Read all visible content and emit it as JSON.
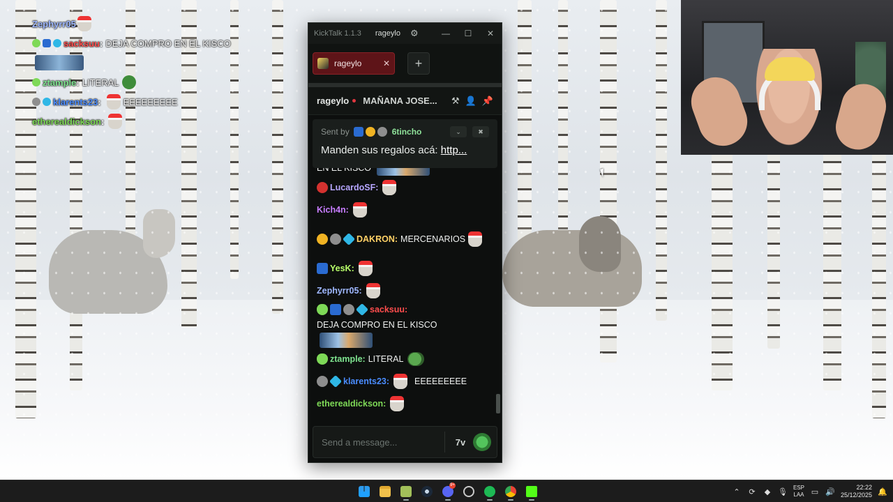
{
  "overlay": {
    "lines": [
      {
        "user": "Zephyrr05",
        "user_color": "#9fb8ff",
        "message": ""
      },
      {
        "user": "sacksuu",
        "user_color": "#ff4d4d",
        "message": "DEJA COMPRO EN EL KISCO"
      },
      {
        "user": "ztample",
        "user_color": "#7ee38f",
        "message": "LITERAL"
      },
      {
        "user": "klarents23",
        "user_color": "#4a8cff",
        "message": "EEEEEEEEE"
      },
      {
        "user": "etherealdickson",
        "user_color": "#7ed957",
        "message": ""
      }
    ]
  },
  "kicktalk": {
    "app_title": "KickTalk 1.1.3",
    "titlebar_channel": "rageylo",
    "tabs": [
      {
        "label": "rageylo"
      }
    ],
    "stream": {
      "streamer": "rageylo",
      "title": "MAÑANA JOSE..."
    },
    "pinned": {
      "sent_by_label": "Sent by",
      "user": "6tincho",
      "message_prefix": "Manden sus regalos acá: ",
      "link": "http..."
    },
    "messages": [
      {
        "user": "",
        "user_color": "#ffffff",
        "text": "EN EL KISCO",
        "badges": [],
        "emote": "wide"
      },
      {
        "user": "LucardoSF:",
        "user_color": "#b6a6ff",
        "text": "",
        "badges": [
          "red"
        ],
        "emote": "skull"
      },
      {
        "user": "Kich4n:",
        "user_color": "#c77dff",
        "text": "",
        "badges": [],
        "emote": "skull"
      },
      {
        "user": "DAKRON:",
        "user_color": "#ffd166",
        "text": "MERCENARIOS",
        "badges": [
          "one",
          "grey",
          "cube"
        ],
        "emote": "skull"
      },
      {
        "user": "YesK:",
        "user_color": "#b8ff6a",
        "text": "",
        "badges": [
          "sword"
        ],
        "emote": "skull"
      },
      {
        "user": "Zephyrr05:",
        "user_color": "#9fb8ff",
        "text": "",
        "badges": [],
        "emote": "skull"
      },
      {
        "user": "sacksuu:",
        "user_color": "#ff4d4d",
        "text": "DEJA COMPRO EN EL KISCO",
        "badges": [
          "alien",
          "sword",
          "grey",
          "cube"
        ],
        "emote": "wide"
      },
      {
        "user": "ztample:",
        "user_color": "#7ee38f",
        "text": "LITERAL",
        "badges": [
          "alien"
        ],
        "emote": "frog"
      },
      {
        "user": "klarents23:",
        "user_color": "#4a8cff",
        "text": "EEEEEEEEE",
        "badges": [
          "grey",
          "cube"
        ],
        "emote": "skull-before"
      },
      {
        "user": "etherealdickson:",
        "user_color": "#7ed957",
        "text": "",
        "badges": [],
        "emote": "skull"
      }
    ],
    "input_placeholder": "Send a message...",
    "input_btn_label": "7v"
  },
  "taskbar": {
    "icons": [
      "start-icon",
      "file-explorer-icon",
      "app-icon",
      "steam-icon",
      "discord-icon",
      "clock-app-icon",
      "spotify-icon",
      "chrome-icon",
      "kick-icon"
    ],
    "discord_badge": "9+",
    "lang_top": "ESP",
    "lang_bottom": "LAA",
    "time": "22:22",
    "date": "25/12/2025"
  }
}
